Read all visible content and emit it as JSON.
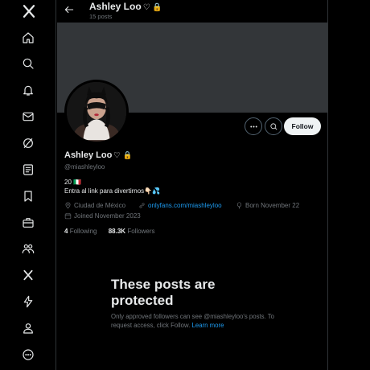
{
  "nav": {
    "items": [
      {
        "name": "x-logo-icon",
        "label": "X"
      },
      {
        "name": "home-icon",
        "label": "Home"
      },
      {
        "name": "search-icon",
        "label": "Explore"
      },
      {
        "name": "bell-icon",
        "label": "Notifications"
      },
      {
        "name": "mail-icon",
        "label": "Messages"
      },
      {
        "name": "grok-icon",
        "label": "Grok"
      },
      {
        "name": "lists-icon",
        "label": "Lists"
      },
      {
        "name": "bookmark-icon",
        "label": "Bookmarks"
      },
      {
        "name": "briefcase-icon",
        "label": "Jobs"
      },
      {
        "name": "communities-icon",
        "label": "Communities"
      },
      {
        "name": "premium-x-icon",
        "label": "Premium"
      },
      {
        "name": "bolt-icon",
        "label": "Verified Orgs"
      },
      {
        "name": "profile-icon",
        "label": "Profile"
      },
      {
        "name": "more-icon",
        "label": "More"
      }
    ]
  },
  "header": {
    "name": "Ashley Loo",
    "glyphs": "♡ 🔒",
    "posts": "15 posts"
  },
  "profile": {
    "name": "Ashley Loo",
    "glyphs": "♡ 🔒",
    "handle": "@miashleyloo",
    "bio_line1": "20 🇮🇹",
    "bio_line2": "Entra al link para divertirnos👇🏻💦",
    "location": "Ciudad de México",
    "link": "onlyfans.com/miashleyloo",
    "birthday": "Born November 22",
    "joined": "Joined November 2023",
    "following_count": "4",
    "following_label": "Following",
    "followers_count": "88.3K",
    "followers_label": "Followers",
    "follow_button": "Follow"
  },
  "protected": {
    "title": "These posts are protected",
    "text": "Only approved followers can see @miashleyloo's posts. To request access, click Follow.",
    "link": "Learn more"
  },
  "colors": {
    "background": "#000000",
    "banner": "#333639",
    "accent_link": "#1d9bf0",
    "muted": "#71767b",
    "follow_bg": "#eff3f4"
  }
}
